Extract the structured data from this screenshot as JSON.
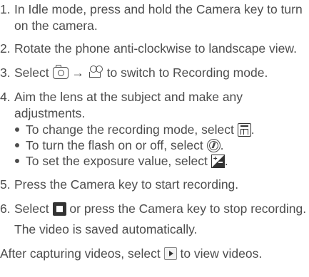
{
  "steps": [
    {
      "number": "1.",
      "text": "In Idle mode, press and hold the Camera key to turn on the camera."
    },
    {
      "number": "2.",
      "text": "Rotate the phone anti-clockwise to landscape view."
    },
    {
      "number": "3.",
      "text_before": "Select",
      "text_after": "to switch to Recording mode.",
      "arrow": "→"
    },
    {
      "number": "4.",
      "text": "Aim the lens at the subject and make any adjustments.",
      "bullets": [
        {
          "text": "To change the recording mode, select",
          "end": "."
        },
        {
          "text": "To turn the flash on or off, select",
          "end": "."
        },
        {
          "text": "To set the exposure value, select",
          "end": "."
        }
      ]
    },
    {
      "number": "5.",
      "text": "Press the Camera key to start recording."
    },
    {
      "number": "6.",
      "text_before": "Select",
      "text_after": "or press the Camera key to stop recording.",
      "note": "The video is saved automatically."
    }
  ],
  "footer": {
    "text_before": "After capturing videos, select",
    "text_after": "to view videos."
  },
  "icons": {
    "camera": "camera-mode-icon",
    "recording": "recording-mode-icon",
    "record_mode": "record-mode-setting-icon",
    "flash": "flash-icon",
    "exposure": "exposure-value-icon",
    "stop": "stop-icon",
    "play": "play-icon"
  }
}
